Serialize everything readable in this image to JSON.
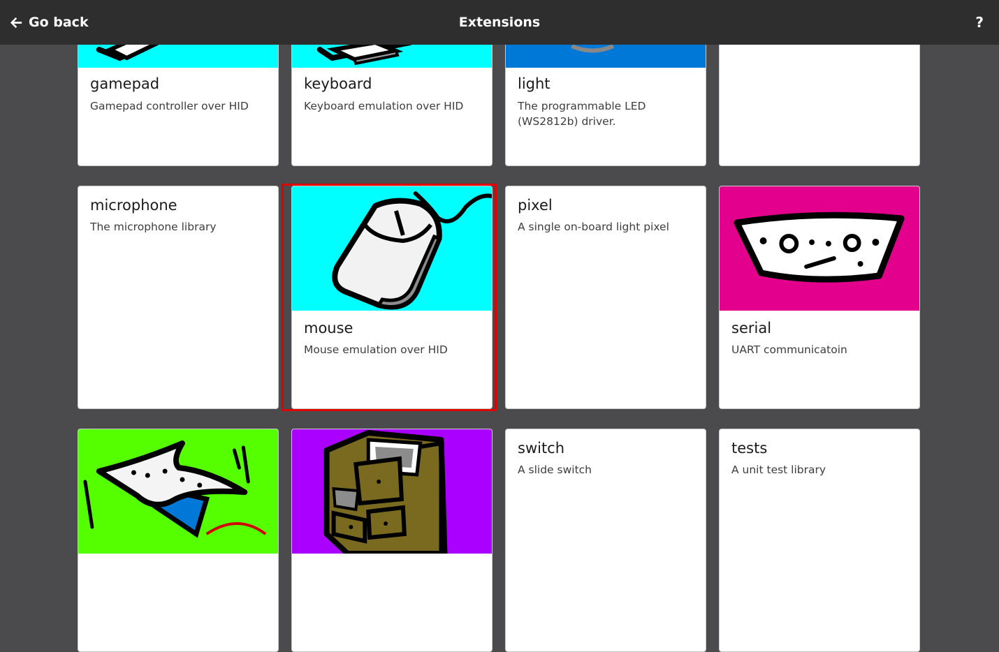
{
  "header": {
    "go_back_label": "Go back",
    "title": "Extensions",
    "help_label": "?"
  },
  "extensions": [
    {
      "name": "gamepad",
      "description": "Gamepad controller over HID",
      "image_bg": "#00ffff",
      "icon": "gamepad-image"
    },
    {
      "name": "keyboard",
      "description": "Keyboard emulation over HID",
      "image_bg": "#00ffff",
      "icon": "keyboard-image"
    },
    {
      "name": "light",
      "description": "The programmable LED (WS2812b) driver.",
      "image_bg": "#0078d7",
      "icon": "light-image"
    },
    {
      "name": "",
      "description": "",
      "icon": "none"
    },
    {
      "name": "microphone",
      "description": "The microphone library",
      "icon": "none"
    },
    {
      "name": "mouse",
      "description": "Mouse emulation over HID",
      "image_bg": "#00ffff",
      "icon": "mouse-image",
      "selected": true
    },
    {
      "name": "pixel",
      "description": "A single on-board light pixel",
      "icon": "none"
    },
    {
      "name": "serial",
      "description": "UART communicatoin",
      "image_bg": "#e3008c",
      "icon": "serial-connector-image"
    },
    {
      "name": "",
      "description": "",
      "image_bg": "#55ff00",
      "icon": "servo-star-image"
    },
    {
      "name": "",
      "description": "",
      "image_bg": "#aa00ff",
      "icon": "storage-drawers-image"
    },
    {
      "name": "switch",
      "description": "A slide switch",
      "icon": "none"
    },
    {
      "name": "tests",
      "description": "A unit test library",
      "icon": "none"
    }
  ],
  "colors": {
    "background": "#4b4b4d",
    "topbar": "#2e2e2e",
    "selection": "#e00000"
  }
}
